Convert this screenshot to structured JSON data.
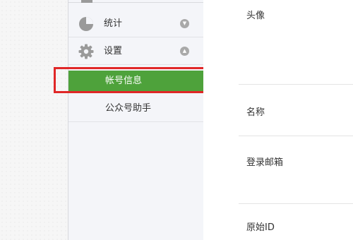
{
  "sidebar": {
    "groups": [
      {
        "label": "统计",
        "icon": "pie-chart-icon",
        "arrow": "chevron-down-icon"
      },
      {
        "label": "设置",
        "icon": "gear-icon",
        "arrow": "chevron-up-icon"
      }
    ],
    "settings_items": [
      {
        "label": "帐号信息",
        "active": true
      },
      {
        "label": "公众号助手",
        "active": false
      }
    ]
  },
  "content": {
    "fields": [
      "头像",
      "名称",
      "登录邮箱",
      "原始ID"
    ]
  },
  "colors": {
    "active_bg": "#4ea23b",
    "highlight_border": "#e02727",
    "icon_gray": "#9a9a9a"
  }
}
